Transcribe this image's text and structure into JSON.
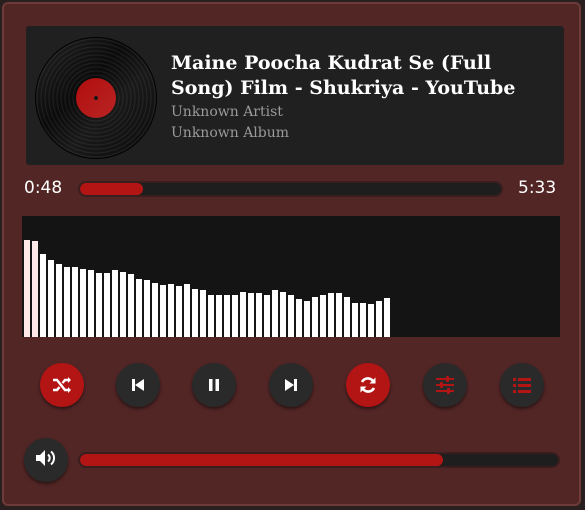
{
  "track": {
    "title": "Maine Poocha Kudrat Se (Full Song) Film - Shukriya - YouTube",
    "artist": "Unknown Artist",
    "album": "Unknown Album"
  },
  "playback": {
    "current_time": "0:48",
    "duration": "5:33",
    "progress": 0.15,
    "volume": 0.76
  },
  "visualizer": {
    "levels": [
      0.8,
      0.79,
      0.69,
      0.64,
      0.6,
      0.58,
      0.58,
      0.56,
      0.55,
      0.53,
      0.53,
      0.55,
      0.54,
      0.52,
      0.48,
      0.47,
      0.45,
      0.43,
      0.44,
      0.42,
      0.44,
      0.4,
      0.39,
      0.35,
      0.35,
      0.35,
      0.35,
      0.37,
      0.36,
      0.36,
      0.35,
      0.39,
      0.37,
      0.35,
      0.31,
      0.3,
      0.33,
      0.35,
      0.36,
      0.36,
      0.33,
      0.28,
      0.28,
      0.27,
      0.3,
      0.32
    ],
    "highlight_bars": 2
  },
  "controls": [
    {
      "name": "shuffle-button",
      "icon": "shuffle-icon",
      "active": true
    },
    {
      "name": "previous-button",
      "icon": "skip-back-icon",
      "active": false
    },
    {
      "name": "pause-button",
      "icon": "pause-icon",
      "active": false
    },
    {
      "name": "next-button",
      "icon": "skip-forward-icon",
      "active": false
    },
    {
      "name": "repeat-button",
      "icon": "repeat-icon",
      "active": true
    },
    {
      "name": "equalizer-button",
      "icon": "sliders-icon",
      "active": false
    },
    {
      "name": "playlist-button",
      "icon": "list-icon",
      "active": false
    }
  ],
  "volume_button": {
    "icon": "volume-icon"
  },
  "colors": {
    "accent": "#b31515",
    "window_bg": "#532626",
    "card_bg": "#202020"
  }
}
